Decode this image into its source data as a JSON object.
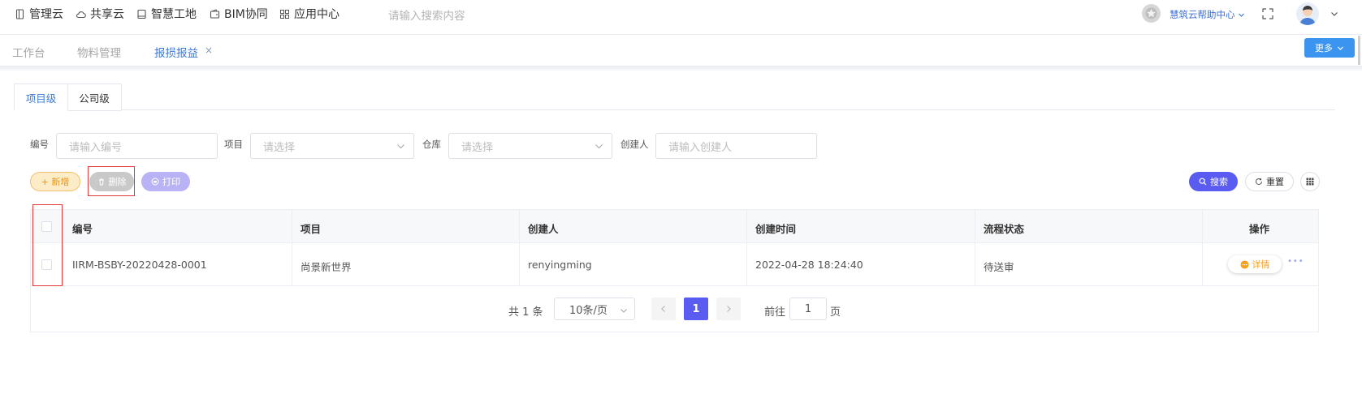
{
  "nav": {
    "items": [
      {
        "label": "管理云",
        "icon": "tablet-icon"
      },
      {
        "label": "共享云",
        "icon": "cloud-icon"
      },
      {
        "label": "智慧工地",
        "icon": "book-icon"
      },
      {
        "label": "BIM协同",
        "icon": "wallet-icon"
      },
      {
        "label": "应用中心",
        "icon": "grid-icon"
      }
    ],
    "search_placeholder": "请输入搜索内容",
    "help": "慧筑云帮助中心"
  },
  "tabs": {
    "items": [
      "工作台",
      "物料管理",
      "报损报益"
    ],
    "close": "×",
    "more": "更多"
  },
  "levels": [
    "项目级",
    "公司级"
  ],
  "filters": {
    "code_label": "编号",
    "code_placeholder": "请输入编号",
    "project_label": "项目",
    "project_placeholder": "请选择",
    "warehouse_label": "仓库",
    "warehouse_placeholder": "请选择",
    "creator_label": "创建人",
    "creator_placeholder": "请输入创建人"
  },
  "actions": {
    "add": "+ 新增",
    "delete": "删除",
    "print": "打印",
    "search": "搜索",
    "reset": "重置"
  },
  "table": {
    "columns": [
      "编号",
      "项目",
      "创建人",
      "创建时间",
      "流程状态",
      "操作"
    ],
    "rows": [
      {
        "code": "IIRM-BSBY-20220428-0001",
        "project": "尚景新世界",
        "creator": "renyingming",
        "created": "2022-04-28 18:24:40",
        "status": "待送审",
        "detail": "详情",
        "more": "•••"
      }
    ]
  },
  "pagination": {
    "total": "共 1 条",
    "page_size": "10条/页",
    "current": "1",
    "goto_prefix": "前往",
    "goto_value": "1",
    "goto_suffix": "页"
  },
  "colors": {
    "accent": "#3c78d8",
    "primary_purple": "#5a5bf0",
    "add_orange": "#f5a623",
    "danger_red": "#e3393c",
    "detail_orange": "#f5a01c"
  }
}
